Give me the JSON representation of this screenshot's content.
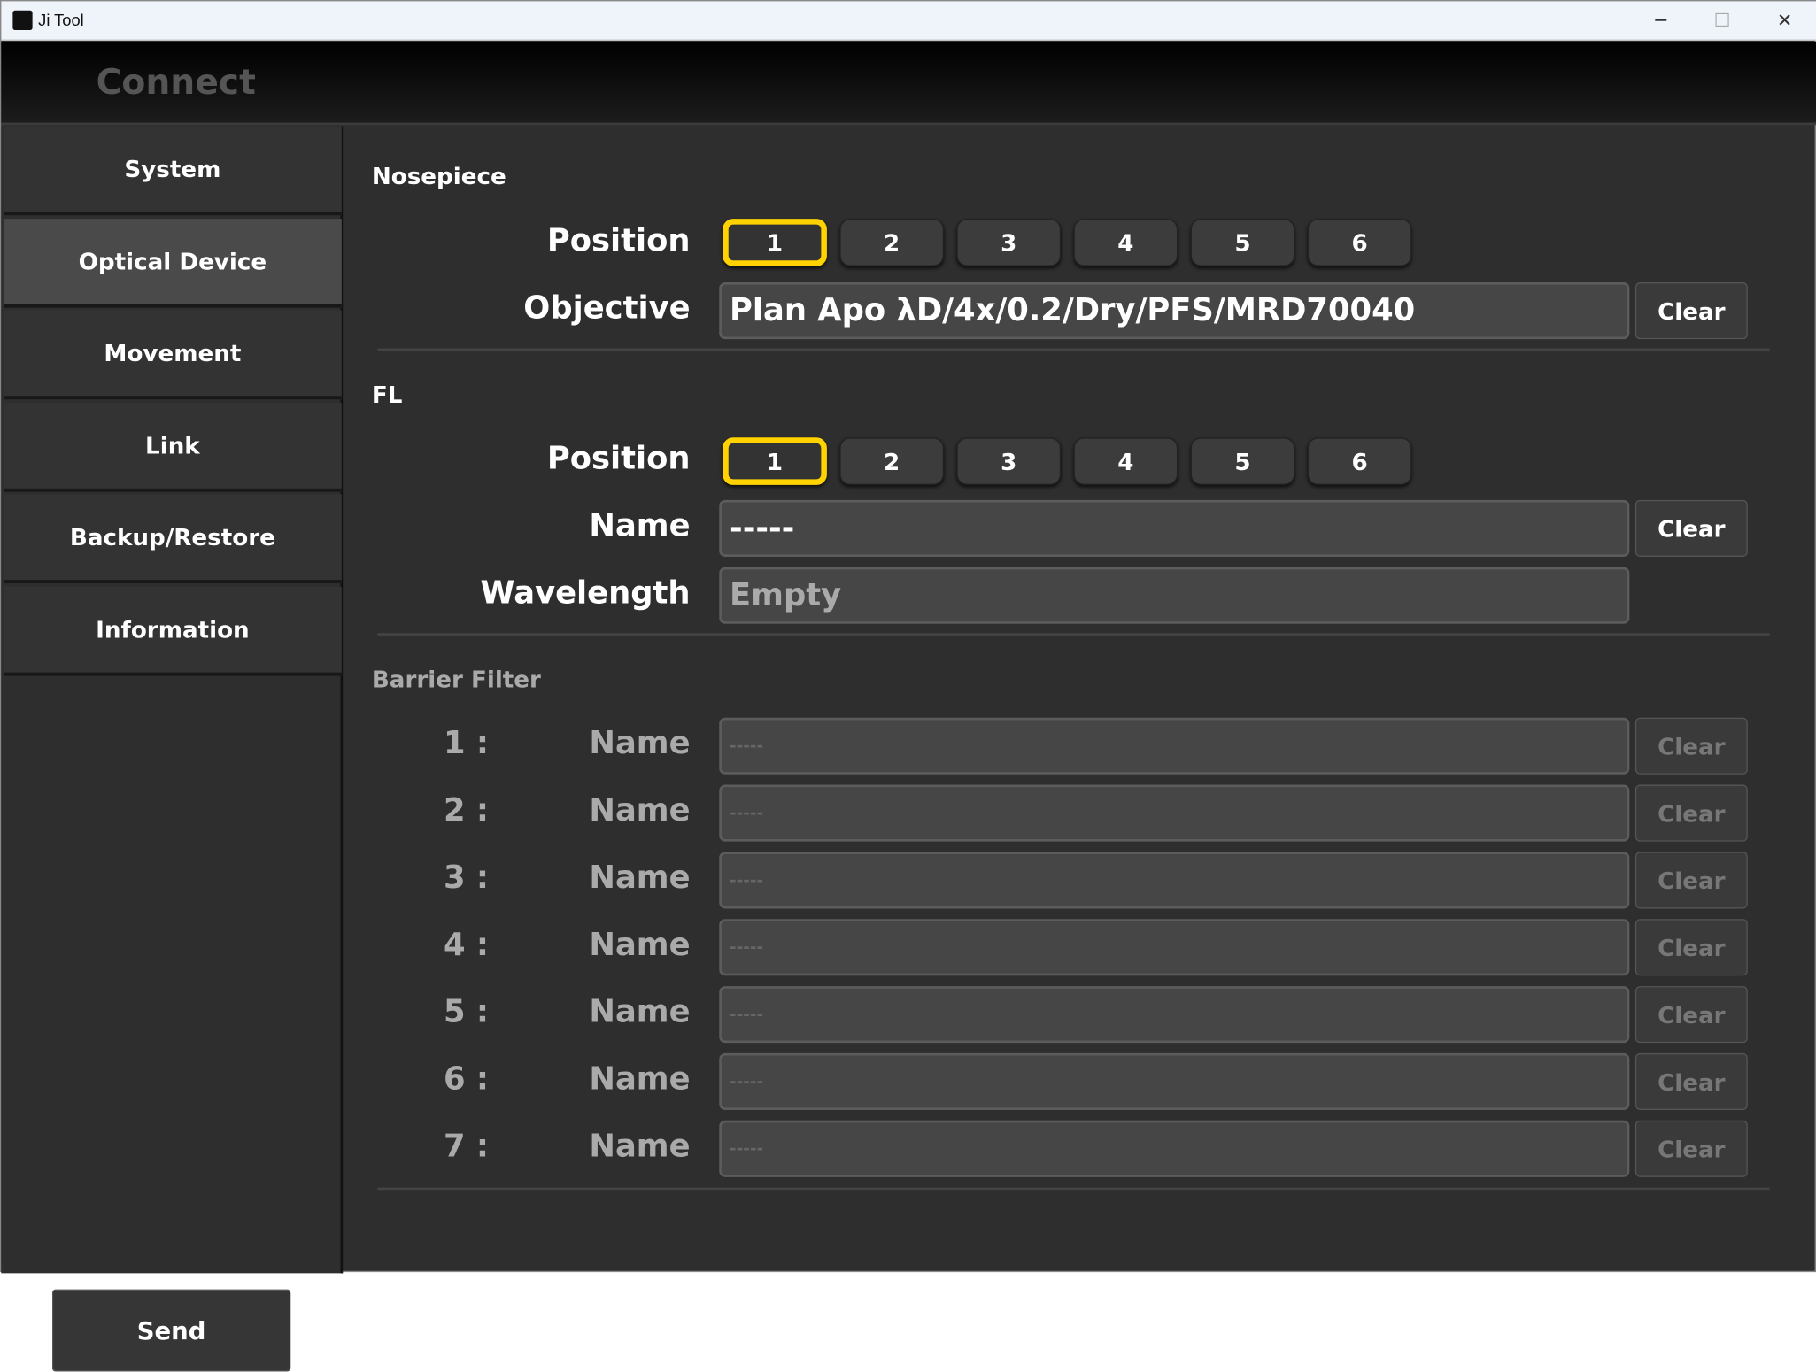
{
  "window": {
    "title": "Ji Tool",
    "minimize": "─",
    "maximize": "☐",
    "close": "✕"
  },
  "header": {
    "connect_label": "Connect"
  },
  "sidebar": {
    "items": [
      {
        "label": "System"
      },
      {
        "label": "Optical Device",
        "active": true
      },
      {
        "label": "Movement"
      },
      {
        "label": "Link"
      },
      {
        "label": "Backup/Restore"
      },
      {
        "label": "Information"
      }
    ],
    "send_label": "Send"
  },
  "nosepiece": {
    "title": "Nosepiece",
    "position_label": "Position",
    "positions": [
      "1",
      "2",
      "3",
      "4",
      "5",
      "6"
    ],
    "selected": "1",
    "objective_label": "Objective",
    "objective_value": "Plan Apo λD/4x/0.2/Dry/PFS/MRD70040",
    "clear_label": "Clear"
  },
  "fl": {
    "title": "FL",
    "position_label": "Position",
    "positions": [
      "1",
      "2",
      "3",
      "4",
      "5",
      "6"
    ],
    "selected": "1",
    "name_label": "Name",
    "name_value": "-----",
    "wavelength_label": "Wavelength",
    "wavelength_value": "Empty",
    "clear_label": "Clear"
  },
  "barrier": {
    "title": "Barrier Filter",
    "rows": [
      {
        "num": "1 :",
        "label": "Name",
        "value": "-----",
        "clear": "Clear"
      },
      {
        "num": "2 :",
        "label": "Name",
        "value": "-----",
        "clear": "Clear"
      },
      {
        "num": "3 :",
        "label": "Name",
        "value": "-----",
        "clear": "Clear"
      },
      {
        "num": "4 :",
        "label": "Name",
        "value": "-----",
        "clear": "Clear"
      },
      {
        "num": "5 :",
        "label": "Name",
        "value": "-----",
        "clear": "Clear"
      },
      {
        "num": "6 :",
        "label": "Name",
        "value": "-----",
        "clear": "Clear"
      },
      {
        "num": "7 :",
        "label": "Name",
        "value": "-----",
        "clear": "Clear"
      }
    ]
  },
  "colors": {
    "selected_border": "#ffd200",
    "background": "#2e2e2e"
  }
}
